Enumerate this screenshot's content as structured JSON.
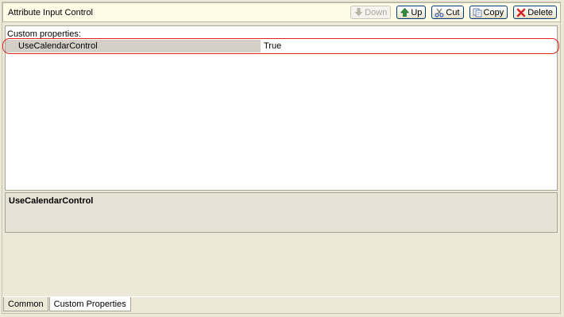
{
  "header": {
    "title": "Attribute Input Control"
  },
  "toolbar": {
    "down_label": "Down",
    "up_label": "Up",
    "cut_label": "Cut",
    "copy_label": "Copy",
    "delete_label": "Delete",
    "down_enabled": false
  },
  "properties": {
    "caption": "Custom properties:",
    "rows": [
      {
        "name": "UseCalendarControl",
        "value": "True"
      }
    ]
  },
  "description": {
    "title": "UseCalendarControl"
  },
  "tabs": [
    {
      "label": "Common",
      "active": false
    },
    {
      "label": "Custom Properties",
      "active": true
    }
  ],
  "colors": {
    "highlight": "#e0261f",
    "header_bg": "#fffbe6",
    "window_bg": "#ece9d8"
  }
}
